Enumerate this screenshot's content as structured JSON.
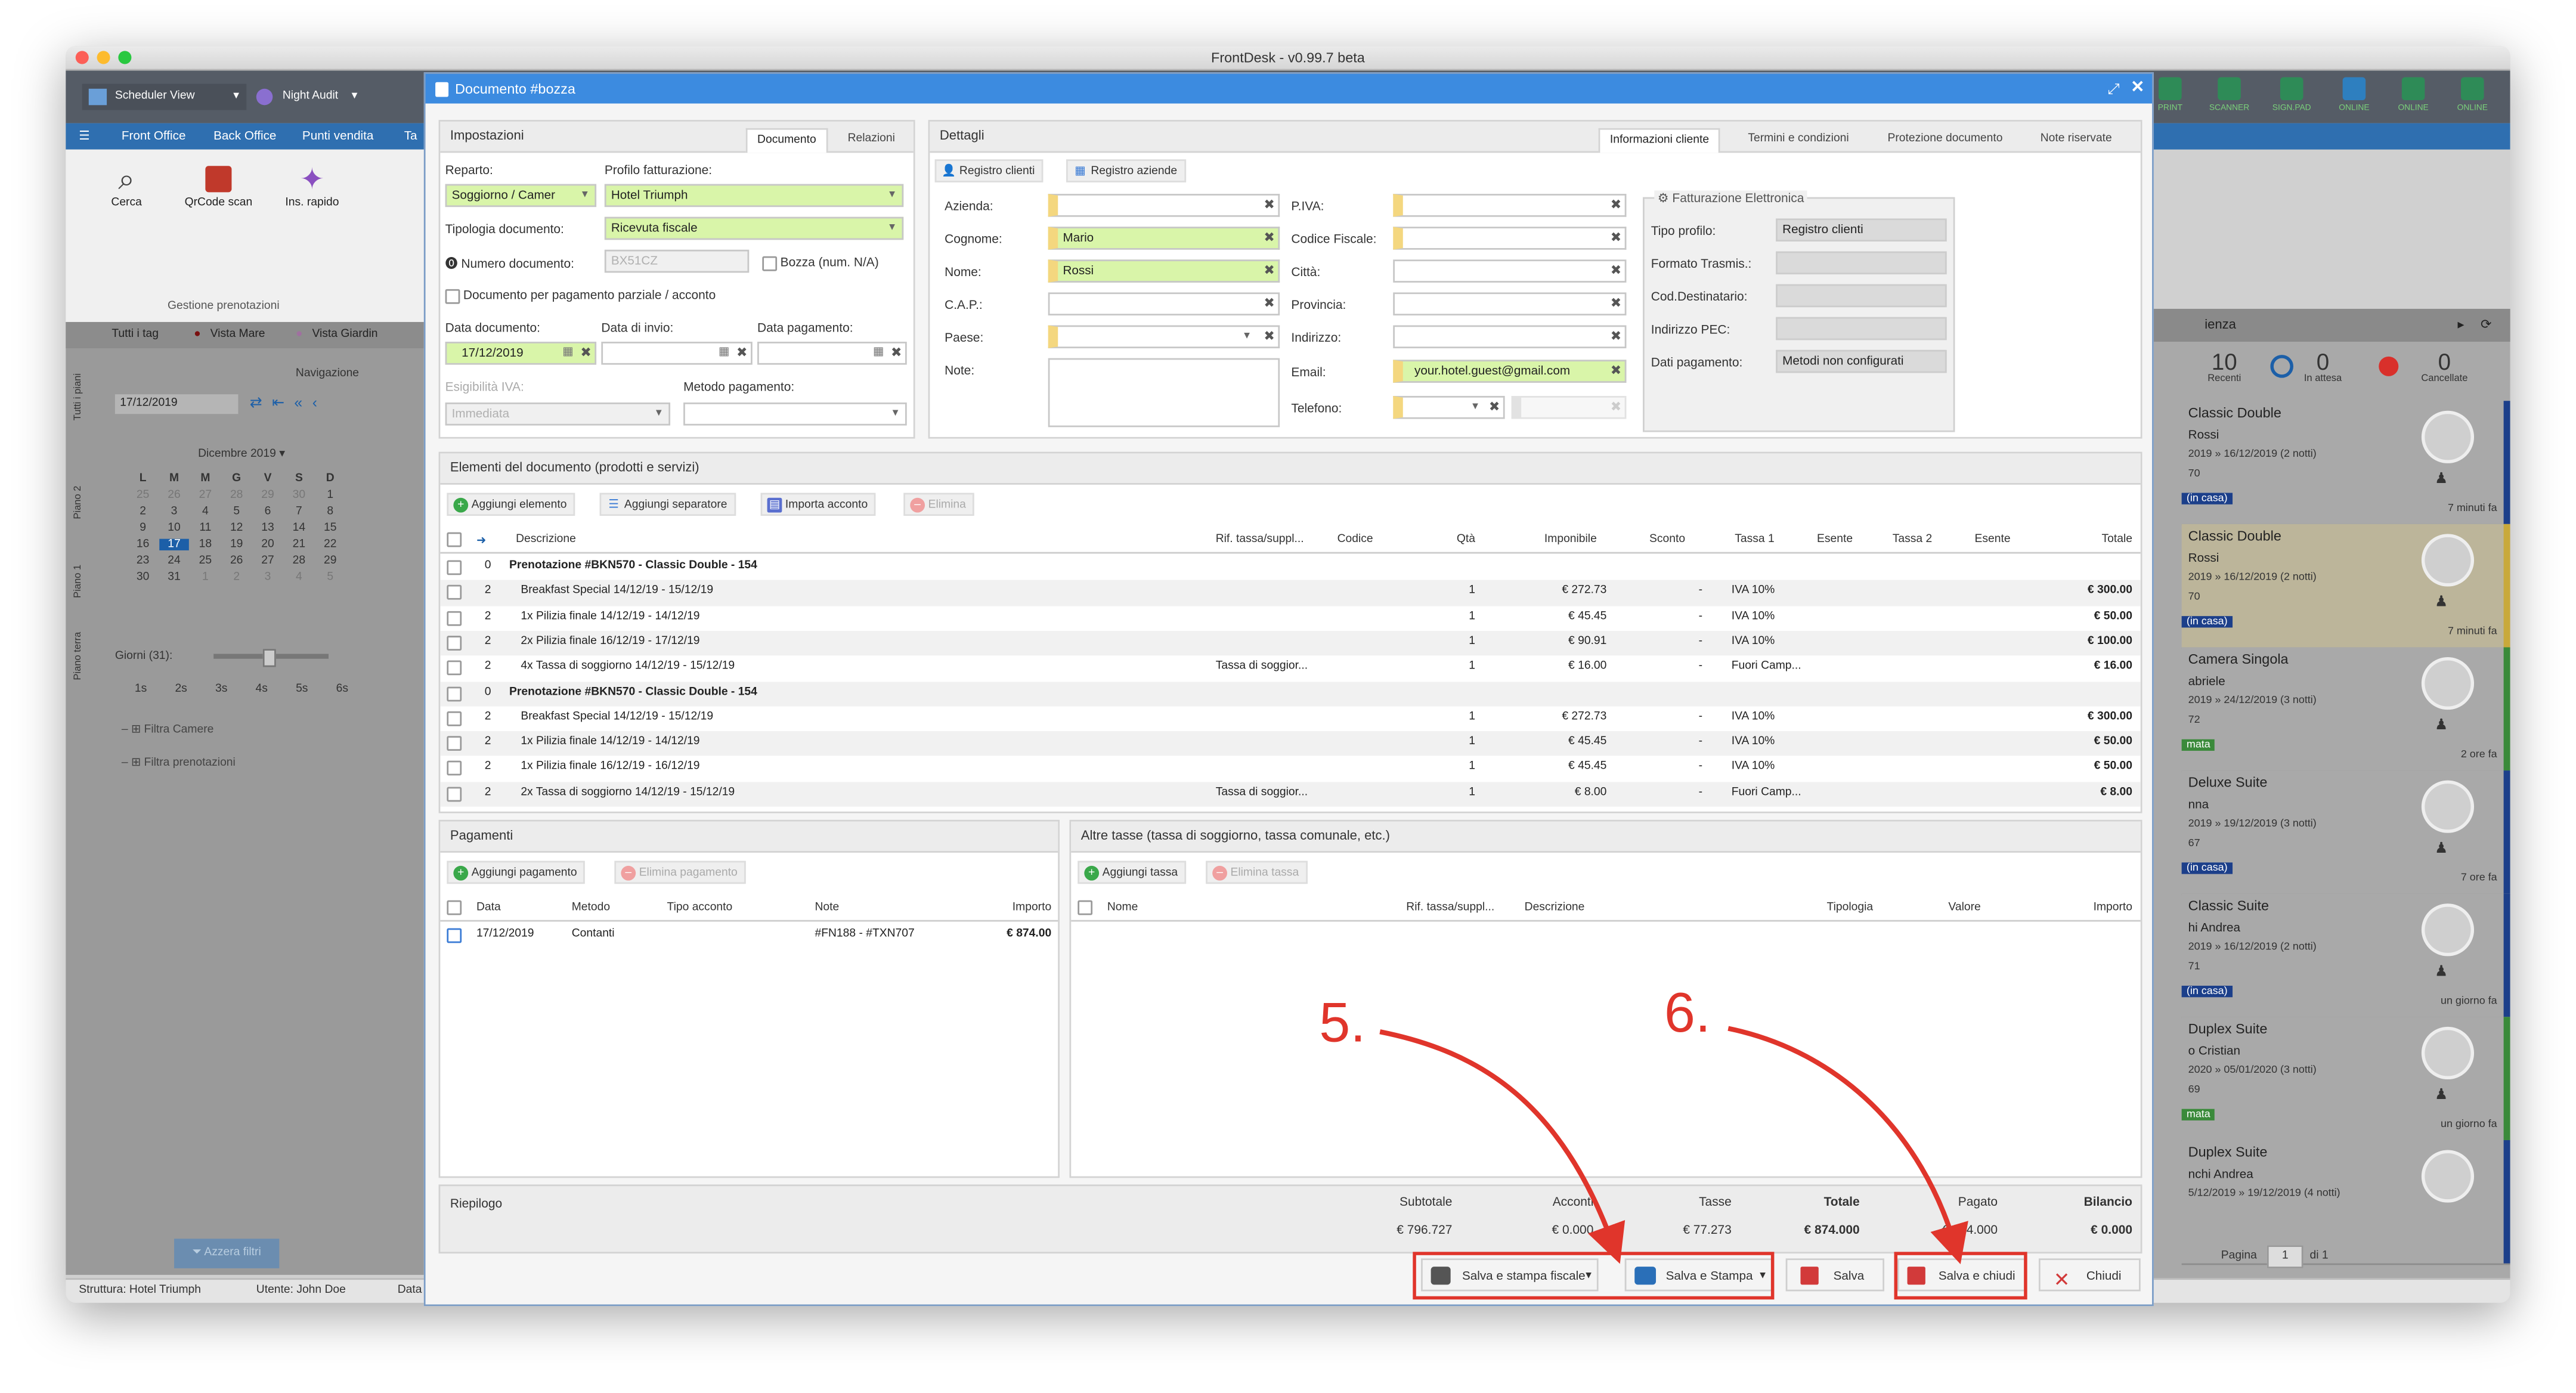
{
  "app": {
    "title": "FrontDesk - v0.99.7 beta"
  },
  "toolbar": {
    "scheduler_view": "Scheduler View",
    "night_audit": "Night Audit",
    "right_icons": [
      "PRINT",
      "SCANNER",
      "SIGN.PAD",
      "ONLINE",
      "ONLINE",
      "ONLINE"
    ]
  },
  "nav": [
    "Front Office",
    "Back Office",
    "Punti vendita",
    "Ta"
  ],
  "ribbon": {
    "buttons": [
      "Cerca",
      "QrCode scan",
      "Ins. rapido"
    ],
    "group": "Gestione prenotazioni"
  },
  "left": {
    "tags": [
      "Tutti i tag",
      "Vista Mare",
      "Vista Giardin"
    ],
    "navigation_label": "Navigazione",
    "date": "17/12/2019",
    "month": "Dicembre 2019",
    "weekdays": [
      "L",
      "M",
      "M",
      "G",
      "V",
      "S",
      "D"
    ],
    "calendar_rows": [
      [
        "25",
        "26",
        "27",
        "28",
        "29",
        "30",
        "1"
      ],
      [
        "2",
        "3",
        "4",
        "5",
        "6",
        "7",
        "8"
      ],
      [
        "9",
        "10",
        "11",
        "12",
        "13",
        "14",
        "15"
      ],
      [
        "16",
        "17",
        "18",
        "19",
        "20",
        "21",
        "22"
      ],
      [
        "23",
        "24",
        "25",
        "26",
        "27",
        "28",
        "29"
      ],
      [
        "30",
        "31",
        "1",
        "2",
        "3",
        "4",
        "5"
      ]
    ],
    "days_label": "Giorni (31):",
    "zoom": [
      "1s",
      "2s",
      "3s",
      "4s",
      "5s",
      "6s"
    ],
    "filters": [
      "Filtra Camere",
      "Filtra prenotazioni"
    ],
    "reset": "Azzera filtri",
    "floors": [
      "Tutti i piani",
      "Piano 2",
      "Piano 1",
      "Piano terra"
    ]
  },
  "right": {
    "title": "ienza",
    "counters": [
      {
        "n": "10",
        "l": "Recenti"
      },
      {
        "n": "0",
        "l": "In attesa"
      },
      {
        "n": "0",
        "l": "Cancellate"
      }
    ],
    "cards": [
      {
        "room": "Classic Double",
        "name": "Rossi",
        "dates": "2019 » 16/12/2019 (2 notti)",
        "num": "70",
        "badge": "(in casa)",
        "time": "7 minuti fa"
      },
      {
        "room": "Classic Double",
        "name": "Rossi",
        "dates": "2019 » 16/12/2019 (2 notti)",
        "num": "70",
        "badge": "(in casa)",
        "time": "7 minuti fa"
      },
      {
        "room": "Camera Singola",
        "name": "abriele",
        "dates": "2019 » 24/12/2019 (3 notti)",
        "num": "72",
        "badge": "mata",
        "time": "2 ore fa"
      },
      {
        "room": "Deluxe Suite",
        "name": "nna",
        "dates": "2019 » 19/12/2019 (3 notti)",
        "num": "67",
        "badge": "(in casa)",
        "time": "7 ore fa"
      },
      {
        "room": "Classic Suite",
        "name": "hi Andrea",
        "dates": "2019 » 16/12/2019 (2 notti)",
        "num": "71",
        "badge": "(in casa)",
        "time": "un giorno fa"
      },
      {
        "room": "Duplex Suite",
        "name": "o Cristian",
        "dates": "2020 » 05/01/2020 (3 notti)",
        "num": "69",
        "badge": "mata",
        "time": "un giorno fa"
      },
      {
        "room": "Duplex Suite",
        "name": "nchi Andrea",
        "dates": "5/12/2019 » 19/12/2019 (4 notti)",
        "num": "",
        "badge": "",
        "time": ""
      }
    ],
    "pager": {
      "label": "Pagina",
      "page": "1",
      "of": "di 1"
    }
  },
  "status": {
    "structure": "Struttura: Hotel Triumph",
    "user": "Utente: John Doe",
    "data": "Data"
  },
  "dialog": {
    "title": "Documento #bozza",
    "settings": {
      "header": "Impostazioni",
      "tabs": [
        "Documento",
        "Relazioni"
      ],
      "reparto_label": "Reparto:",
      "reparto": "Soggiorno / Camer",
      "profilo_label": "Profilo fatturazione:",
      "profilo": "Hotel Triumph",
      "tipologia_label": "Tipologia documento:",
      "tipologia": "Ricevuta fiscale",
      "numero_label": "Numero documento:",
      "numero_placeholder": "BX51CZ",
      "bozza_label": "Bozza (num. N/A)",
      "parziale_label": "Documento per pagamento parziale / acconto",
      "data_doc_label": "Data documento:",
      "data_doc": "17/12/2019",
      "data_invio_label": "Data di invio:",
      "data_pag_label": "Data pagamento:",
      "iva_label": "Esigibilità IVA:",
      "iva": "Immediata",
      "metodo_label": "Metodo pagamento:"
    },
    "details": {
      "header": "Dettagli",
      "tabs": [
        "Informazioni cliente",
        "Termini e condizioni",
        "Protezione documento",
        "Note riservate"
      ],
      "reg_clienti": "Registro clienti",
      "reg_aziende": "Registro aziende",
      "azienda": "Azienda:",
      "cognome": "Cognome:",
      "cognome_val": "Mario",
      "nome": "Nome:",
      "nome_val": "Rossi",
      "cap": "C.A.P.:",
      "paese": "Paese:",
      "note": "Note:",
      "piva": "P.IVA:",
      "cf": "Codice Fiscale:",
      "citta": "Città:",
      "provincia": "Provincia:",
      "indirizzo": "Indirizzo:",
      "email": "Email:",
      "email_val": "your.hotel.guest@gmail.com",
      "telefono": "Telefono:",
      "fe_title": "Fatturazione Elettronica",
      "fe": [
        {
          "l": "Tipo profilo:",
          "v": "Registro clienti"
        },
        {
          "l": "Formato Trasmis.:",
          "v": ""
        },
        {
          "l": "Cod.Destinatario:",
          "v": ""
        },
        {
          "l": "Indirizzo PEC:",
          "v": ""
        },
        {
          "l": "Dati pagamento:",
          "v": "Metodi non configurati"
        }
      ]
    },
    "items": {
      "header": "Elementi del documento (prodotti e servizi)",
      "buttons": [
        "Aggiungi elemento",
        "Aggiungi separatore",
        "Importa acconto",
        "Elimina"
      ],
      "columns": [
        "Descrizione",
        "Rif. tassa/suppl...",
        "Codice",
        "Qtà",
        "Imponibile",
        "Sconto",
        "Tassa 1",
        "Esente",
        "Tassa 2",
        "Esente",
        "Totale"
      ],
      "rows": [
        {
          "n": "0",
          "d": "Prenotazione #BKN570 - Classic Double - 154",
          "group": true
        },
        {
          "n": "2",
          "d": "Breakfast Special 14/12/19 - 15/12/19",
          "rif": "",
          "q": "1",
          "imp": "€ 272.73",
          "sc": "-",
          "t1": "IVA 10%",
          "tot": "€ 300.00"
        },
        {
          "n": "2",
          "d": "1x Pilizia finale 14/12/19 - 14/12/19",
          "rif": "",
          "q": "1",
          "imp": "€ 45.45",
          "sc": "-",
          "t1": "IVA 10%",
          "tot": "€ 50.00"
        },
        {
          "n": "2",
          "d": "2x Pilizia finale 16/12/19 - 17/12/19",
          "rif": "",
          "q": "1",
          "imp": "€ 90.91",
          "sc": "-",
          "t1": "IVA 10%",
          "tot": "€ 100.00"
        },
        {
          "n": "2",
          "d": "4x Tassa di soggiorno 14/12/19 - 15/12/19",
          "rif": "Tassa di soggior...",
          "q": "1",
          "imp": "€ 16.00",
          "sc": "-",
          "t1": "Fuori Camp...",
          "tot": "€ 16.00"
        },
        {
          "n": "0",
          "d": "Prenotazione #BKN570 - Classic Double - 154",
          "group": true
        },
        {
          "n": "2",
          "d": "Breakfast Special 14/12/19 - 15/12/19",
          "rif": "",
          "q": "1",
          "imp": "€ 272.73",
          "sc": "-",
          "t1": "IVA 10%",
          "tot": "€ 300.00"
        },
        {
          "n": "2",
          "d": "1x Pilizia finale 14/12/19 - 14/12/19",
          "rif": "",
          "q": "1",
          "imp": "€ 45.45",
          "sc": "-",
          "t1": "IVA 10%",
          "tot": "€ 50.00"
        },
        {
          "n": "2",
          "d": "1x Pilizia finale 16/12/19 - 16/12/19",
          "rif": "",
          "q": "1",
          "imp": "€ 45.45",
          "sc": "-",
          "t1": "IVA 10%",
          "tot": "€ 50.00"
        },
        {
          "n": "2",
          "d": "2x Tassa di soggiorno 14/12/19 - 15/12/19",
          "rif": "Tassa di soggior...",
          "q": "1",
          "imp": "€ 8.00",
          "sc": "-",
          "t1": "Fuori Camp...",
          "tot": "€ 8.00"
        }
      ]
    },
    "payments": {
      "header": "Pagamenti",
      "add": "Aggiungi pagamento",
      "delete": "Elimina pagamento",
      "columns": [
        "Data",
        "Metodo",
        "Tipo acconto",
        "Note",
        "Importo"
      ],
      "rows": [
        {
          "data": "17/12/2019",
          "metodo": "Contanti",
          "tipo": "",
          "note": "#FN188 - #TXN707",
          "importo": "€ 874.00"
        }
      ]
    },
    "taxes": {
      "header": "Altre tasse (tassa di soggiorno, tassa comunale, etc.)",
      "add": "Aggiungi tassa",
      "delete": "Elimina tassa",
      "columns": [
        "Nome",
        "Rif. tassa/suppl...",
        "Descrizione",
        "Tipologia",
        "Valore",
        "Importo"
      ]
    },
    "summary": {
      "label": "Riepilogo",
      "cols": [
        {
          "l": "Subtotale",
          "v": "€ 796.727",
          "bold": false
        },
        {
          "l": "Acconti",
          "v": "€ 0.000",
          "bold": false
        },
        {
          "l": "Tasse",
          "v": "€ 77.273",
          "bold": false
        },
        {
          "l": "Totale",
          "v": "€ 874.000",
          "bold": true
        },
        {
          "l": "Pagato",
          "v": "€ 874.000",
          "bold": false
        },
        {
          "l": "Bilancio",
          "v": "€ 0.000",
          "bold": true
        }
      ]
    },
    "footer": {
      "save_print_fiscal": "Salva e stampa fiscale",
      "save_print": "Salva e Stampa",
      "save": "Salva",
      "save_close": "Salva e chiudi",
      "close": "Chiudi"
    }
  },
  "annotations": [
    "5.",
    "6."
  ],
  "colors": {
    "accent": "#3c8be0",
    "highlight_green": "#d9f5a9",
    "required_yellow": "#f4d77f",
    "annotation_red": "#e0352b"
  }
}
